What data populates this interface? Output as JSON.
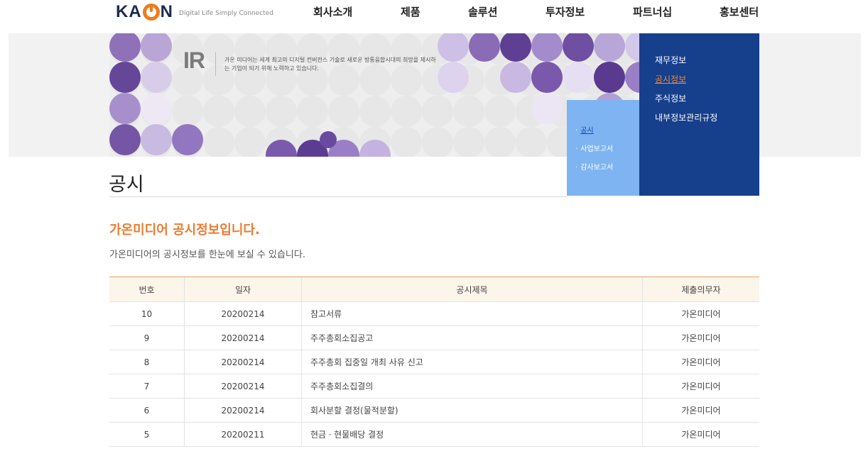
{
  "brand": {
    "logo_text_left": "KA",
    "logo_text_right": "N",
    "tagline": "Digital Life Simply Connected",
    "accent_color": "#f07b1e",
    "navy_color": "#163f8c"
  },
  "nav": {
    "items": [
      {
        "label": "회사소개"
      },
      {
        "label": "제품"
      },
      {
        "label": "솔루션"
      },
      {
        "label": "투자정보"
      },
      {
        "label": "파트너십"
      },
      {
        "label": "홍보센터"
      }
    ]
  },
  "banner": {
    "title": "IR",
    "description": "가온 미디어는 세계 최고의 디지털 컨버전스 기술로 새로운 방통융합시대의 희망을 제시하는 기업이 되기 위해 노력하고 있습니다."
  },
  "side_menu": {
    "items": [
      {
        "label": "재무정보",
        "active": false
      },
      {
        "label": "공시정보",
        "active": true
      },
      {
        "label": "주식정보",
        "active": false
      },
      {
        "label": "내부정보관리규정",
        "active": false
      }
    ]
  },
  "sub_menu": {
    "items": [
      {
        "label": "공시",
        "active": true
      },
      {
        "label": "사업보고서",
        "active": false
      },
      {
        "label": "감사보고서",
        "active": false
      }
    ]
  },
  "page": {
    "title": "공시",
    "section_title": "가온미디어 공시정보입니다.",
    "section_subtitle": "가온미디어의 공시정보를 한눈에 보실 수 있습니다."
  },
  "table": {
    "headers": [
      "번호",
      "일자",
      "공시제목",
      "제출의무자"
    ],
    "rows": [
      [
        "10",
        "20200214",
        "참고서류",
        "가온미디어"
      ],
      [
        "9",
        "20200214",
        "주주총회소집공고",
        "가온미디어"
      ],
      [
        "8",
        "20200214",
        "주주총회 집중일 개최 사유 신고",
        "가온미디어"
      ],
      [
        "7",
        "20200214",
        "주주총회소집결의",
        "가온미디어"
      ],
      [
        "6",
        "20200214",
        "회사분할 결정(물적분할)",
        "가온미디어"
      ],
      [
        "5",
        "20200211",
        "현금ㆍ현물배당 결정",
        "가온미디어"
      ]
    ]
  }
}
